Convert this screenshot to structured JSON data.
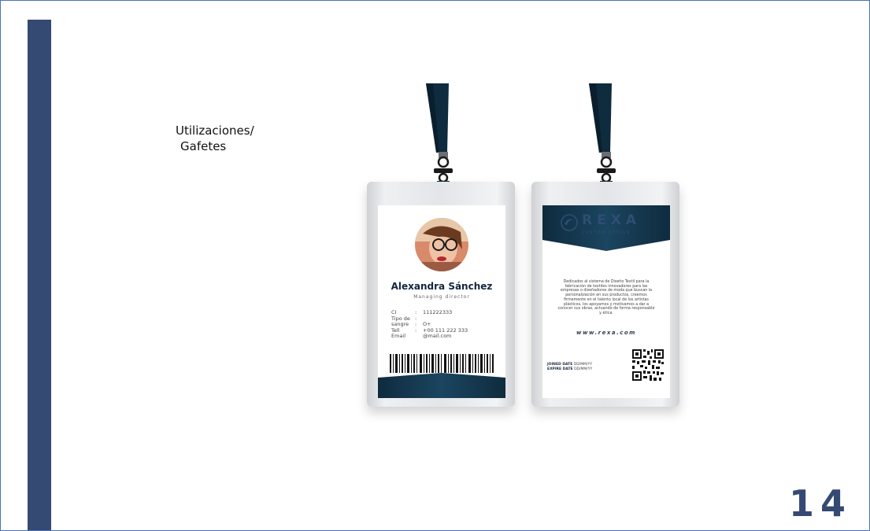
{
  "slide": {
    "title_line1": "Utilizaciones/",
    "title_line2": "Gafetes",
    "page_number": "14"
  },
  "colors": {
    "sidebar": "#354a72",
    "navy": "#14263e",
    "teal_navy": "#0f2b3e",
    "page_number": "#354a72"
  },
  "front_card": {
    "name": "Alexandra Sánchez",
    "role": "Managing director",
    "fields": [
      {
        "label": "CI",
        "sep": ":",
        "value": "111222333"
      },
      {
        "label": "Tipo de",
        "sep": ":",
        "value": ""
      },
      {
        "label": "sangre",
        "sep": ":",
        "value": "O+"
      },
      {
        "label": "Tell",
        "sep": ":",
        "value": "+00 111 222 333"
      },
      {
        "label": "Email",
        "sep": "",
        "value": "@mail.com"
      }
    ]
  },
  "back_card": {
    "brand": "REXA",
    "brand_sub": "CUSTOM DESIGN",
    "description": "Dedicados al sistema de Diseño Textil para la fabricación de textiles innovadores para las empresas o diseñadores de moda que buscan la personalización en sus productos, creemos firmemente en el talento local de los artistas plásticos, los apoyamos y motivamos a dar a conocer sus obras, actuando de forma responsable y ética.",
    "website": "www.rexa.com",
    "joined_label": "JOINED DATE",
    "joined_value": "DD/MM/YY",
    "expire_label": "EXPIRE DATE",
    "expire_value": "DD/MM/YY"
  }
}
